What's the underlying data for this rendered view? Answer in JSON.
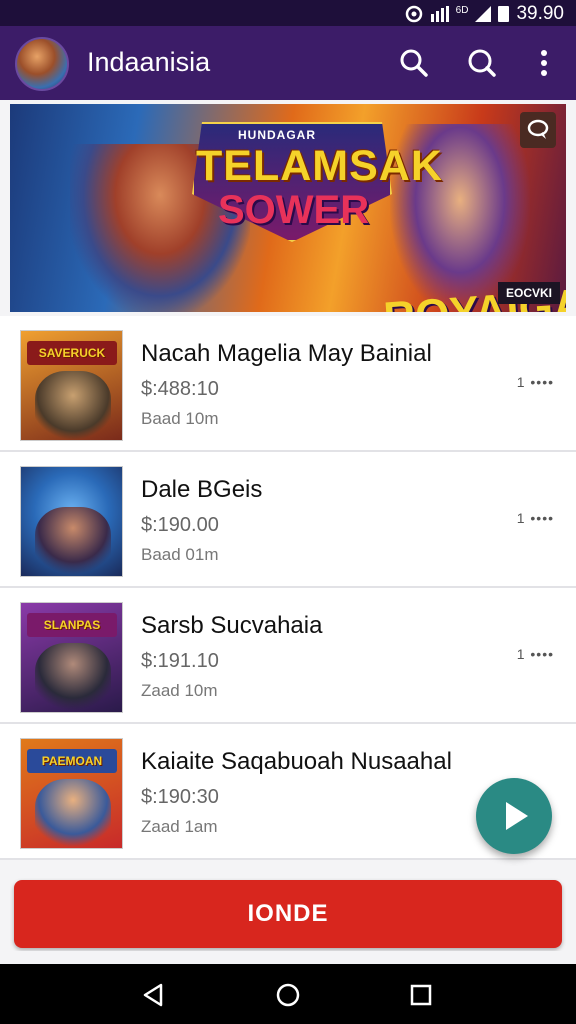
{
  "status_bar": {
    "time": "39.90",
    "network": "6D"
  },
  "app_bar": {
    "title": "Indaanisia"
  },
  "banner": {
    "logo_small": "HUNDAGAR",
    "logo_line1": "TELAMSAK",
    "logo_line2": "SOWER",
    "subtitle": "ROYAIGA",
    "tag": "EOCVKI"
  },
  "items": [
    {
      "title": "Nacah Magelia May Bainial",
      "price": "$:488:10",
      "date": "Baad 10m",
      "more": "1 ••••",
      "thumb_label": "SAVERUCK",
      "colors": [
        "#f0a030",
        "#7a2a1a"
      ]
    },
    {
      "title": "Dale BGeis",
      "price": "$:190.00",
      "date": "Baad 01m",
      "more": "1 ••••",
      "thumb_label": "",
      "colors": [
        "#2a6ab8",
        "#1a2a5a"
      ]
    },
    {
      "title": "Sarsb Sucvahaia",
      "price": "$:191.10",
      "date": "Zaad 10m",
      "more": "1 ••••",
      "thumb_label": "SLANPAS",
      "colors": [
        "#8a3aa8",
        "#2a1a4a"
      ]
    },
    {
      "title": "Kaiaite Saqabuoah Nusaahal",
      "price": "$:190:30",
      "date": "Zaad 1am",
      "more": "",
      "thumb_label": "PAEMOAN",
      "colors": [
        "#e07a1a",
        "#c82a2a"
      ]
    }
  ],
  "cta": {
    "label": "IONDE"
  }
}
